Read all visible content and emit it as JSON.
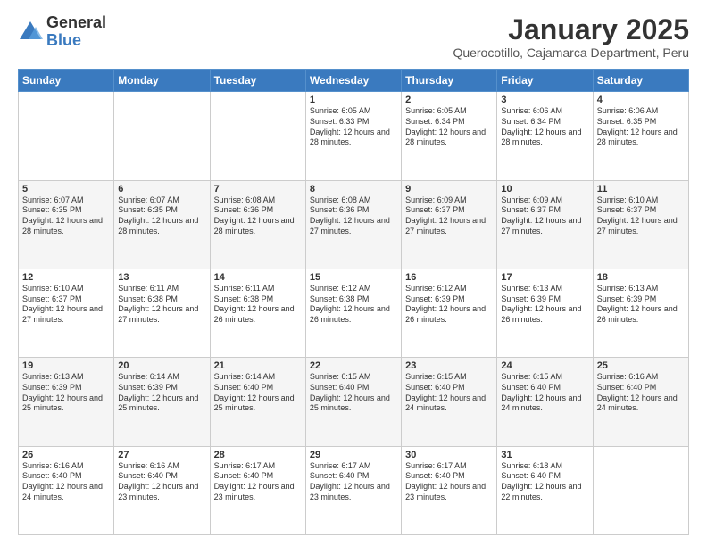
{
  "logo": {
    "general": "General",
    "blue": "Blue"
  },
  "title": {
    "month": "January 2025",
    "location": "Querocotillo, Cajamarca Department, Peru"
  },
  "weekdays": [
    "Sunday",
    "Monday",
    "Tuesday",
    "Wednesday",
    "Thursday",
    "Friday",
    "Saturday"
  ],
  "weeks": [
    [
      {
        "day": "",
        "info": ""
      },
      {
        "day": "",
        "info": ""
      },
      {
        "day": "",
        "info": ""
      },
      {
        "day": "1",
        "info": "Sunrise: 6:05 AM\nSunset: 6:33 PM\nDaylight: 12 hours and 28 minutes."
      },
      {
        "day": "2",
        "info": "Sunrise: 6:05 AM\nSunset: 6:34 PM\nDaylight: 12 hours and 28 minutes."
      },
      {
        "day": "3",
        "info": "Sunrise: 6:06 AM\nSunset: 6:34 PM\nDaylight: 12 hours and 28 minutes."
      },
      {
        "day": "4",
        "info": "Sunrise: 6:06 AM\nSunset: 6:35 PM\nDaylight: 12 hours and 28 minutes."
      }
    ],
    [
      {
        "day": "5",
        "info": "Sunrise: 6:07 AM\nSunset: 6:35 PM\nDaylight: 12 hours and 28 minutes."
      },
      {
        "day": "6",
        "info": "Sunrise: 6:07 AM\nSunset: 6:35 PM\nDaylight: 12 hours and 28 minutes."
      },
      {
        "day": "7",
        "info": "Sunrise: 6:08 AM\nSunset: 6:36 PM\nDaylight: 12 hours and 28 minutes."
      },
      {
        "day": "8",
        "info": "Sunrise: 6:08 AM\nSunset: 6:36 PM\nDaylight: 12 hours and 27 minutes."
      },
      {
        "day": "9",
        "info": "Sunrise: 6:09 AM\nSunset: 6:37 PM\nDaylight: 12 hours and 27 minutes."
      },
      {
        "day": "10",
        "info": "Sunrise: 6:09 AM\nSunset: 6:37 PM\nDaylight: 12 hours and 27 minutes."
      },
      {
        "day": "11",
        "info": "Sunrise: 6:10 AM\nSunset: 6:37 PM\nDaylight: 12 hours and 27 minutes."
      }
    ],
    [
      {
        "day": "12",
        "info": "Sunrise: 6:10 AM\nSunset: 6:37 PM\nDaylight: 12 hours and 27 minutes."
      },
      {
        "day": "13",
        "info": "Sunrise: 6:11 AM\nSunset: 6:38 PM\nDaylight: 12 hours and 27 minutes."
      },
      {
        "day": "14",
        "info": "Sunrise: 6:11 AM\nSunset: 6:38 PM\nDaylight: 12 hours and 26 minutes."
      },
      {
        "day": "15",
        "info": "Sunrise: 6:12 AM\nSunset: 6:38 PM\nDaylight: 12 hours and 26 minutes."
      },
      {
        "day": "16",
        "info": "Sunrise: 6:12 AM\nSunset: 6:39 PM\nDaylight: 12 hours and 26 minutes."
      },
      {
        "day": "17",
        "info": "Sunrise: 6:13 AM\nSunset: 6:39 PM\nDaylight: 12 hours and 26 minutes."
      },
      {
        "day": "18",
        "info": "Sunrise: 6:13 AM\nSunset: 6:39 PM\nDaylight: 12 hours and 26 minutes."
      }
    ],
    [
      {
        "day": "19",
        "info": "Sunrise: 6:13 AM\nSunset: 6:39 PM\nDaylight: 12 hours and 25 minutes."
      },
      {
        "day": "20",
        "info": "Sunrise: 6:14 AM\nSunset: 6:39 PM\nDaylight: 12 hours and 25 minutes."
      },
      {
        "day": "21",
        "info": "Sunrise: 6:14 AM\nSunset: 6:40 PM\nDaylight: 12 hours and 25 minutes."
      },
      {
        "day": "22",
        "info": "Sunrise: 6:15 AM\nSunset: 6:40 PM\nDaylight: 12 hours and 25 minutes."
      },
      {
        "day": "23",
        "info": "Sunrise: 6:15 AM\nSunset: 6:40 PM\nDaylight: 12 hours and 24 minutes."
      },
      {
        "day": "24",
        "info": "Sunrise: 6:15 AM\nSunset: 6:40 PM\nDaylight: 12 hours and 24 minutes."
      },
      {
        "day": "25",
        "info": "Sunrise: 6:16 AM\nSunset: 6:40 PM\nDaylight: 12 hours and 24 minutes."
      }
    ],
    [
      {
        "day": "26",
        "info": "Sunrise: 6:16 AM\nSunset: 6:40 PM\nDaylight: 12 hours and 24 minutes."
      },
      {
        "day": "27",
        "info": "Sunrise: 6:16 AM\nSunset: 6:40 PM\nDaylight: 12 hours and 23 minutes."
      },
      {
        "day": "28",
        "info": "Sunrise: 6:17 AM\nSunset: 6:40 PM\nDaylight: 12 hours and 23 minutes."
      },
      {
        "day": "29",
        "info": "Sunrise: 6:17 AM\nSunset: 6:40 PM\nDaylight: 12 hours and 23 minutes."
      },
      {
        "day": "30",
        "info": "Sunrise: 6:17 AM\nSunset: 6:40 PM\nDaylight: 12 hours and 23 minutes."
      },
      {
        "day": "31",
        "info": "Sunrise: 6:18 AM\nSunset: 6:40 PM\nDaylight: 12 hours and 22 minutes."
      },
      {
        "day": "",
        "info": ""
      }
    ]
  ]
}
